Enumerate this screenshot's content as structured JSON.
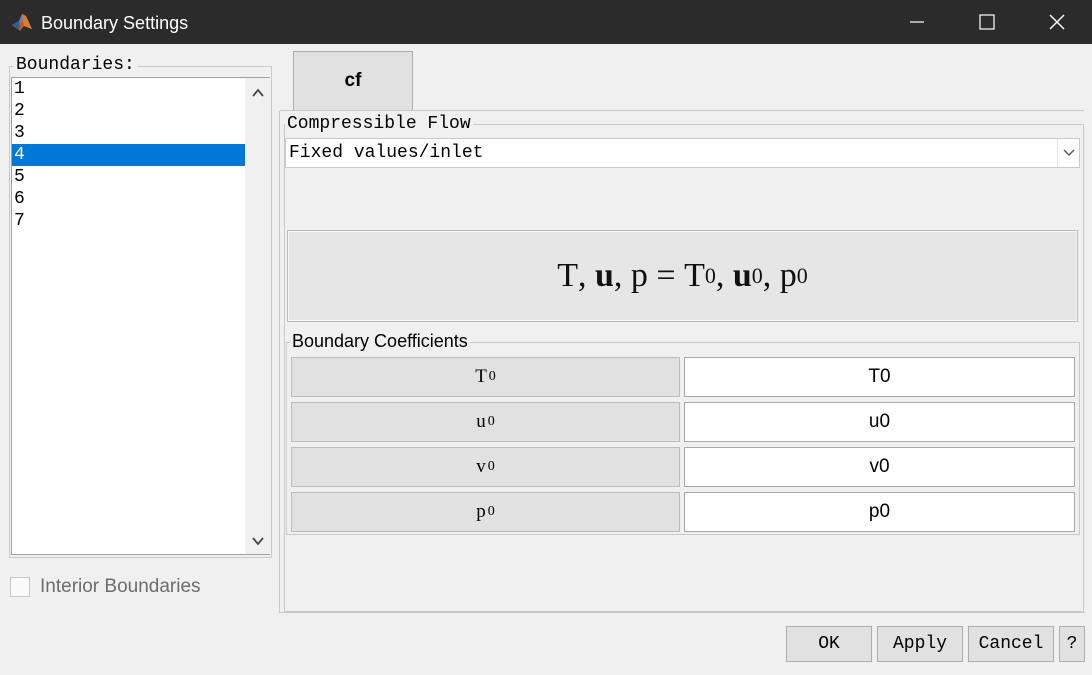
{
  "window": {
    "title": "Boundary Settings",
    "icons": [
      "matlab-logo-icon",
      "minimize-icon",
      "maximize-icon",
      "close-icon"
    ]
  },
  "boundaries": {
    "legend": "Boundaries:",
    "items": [
      "1",
      "2",
      "3",
      "4",
      "5",
      "6",
      "7"
    ],
    "selected": "4"
  },
  "interior": {
    "label": "Interior Boundaries",
    "checked": false
  },
  "tab": {
    "label": "cf"
  },
  "flow": {
    "legend": "Compressible Flow",
    "condition": "Fixed values/inlet",
    "equation": {
      "lhs": [
        "T",
        "u",
        "p"
      ],
      "rhs_base": [
        "T",
        "u",
        "p"
      ],
      "rhs_sub": "0"
    }
  },
  "coefficients": {
    "legend": "Boundary Coefficients",
    "rows": [
      {
        "symbol": "T",
        "sub": "0",
        "value": "T0"
      },
      {
        "symbol": "u",
        "sub": "0",
        "value": "u0"
      },
      {
        "symbol": "v",
        "sub": "0",
        "value": "v0"
      },
      {
        "symbol": "p",
        "sub": "0",
        "value": "p0"
      }
    ]
  },
  "buttons": {
    "ok": "OK",
    "apply": "Apply",
    "cancel": "Cancel",
    "help": "?"
  },
  "colors": {
    "titlebar": "#2b2b2b",
    "selection": "#0078d7",
    "background": "#f0f0f0"
  }
}
